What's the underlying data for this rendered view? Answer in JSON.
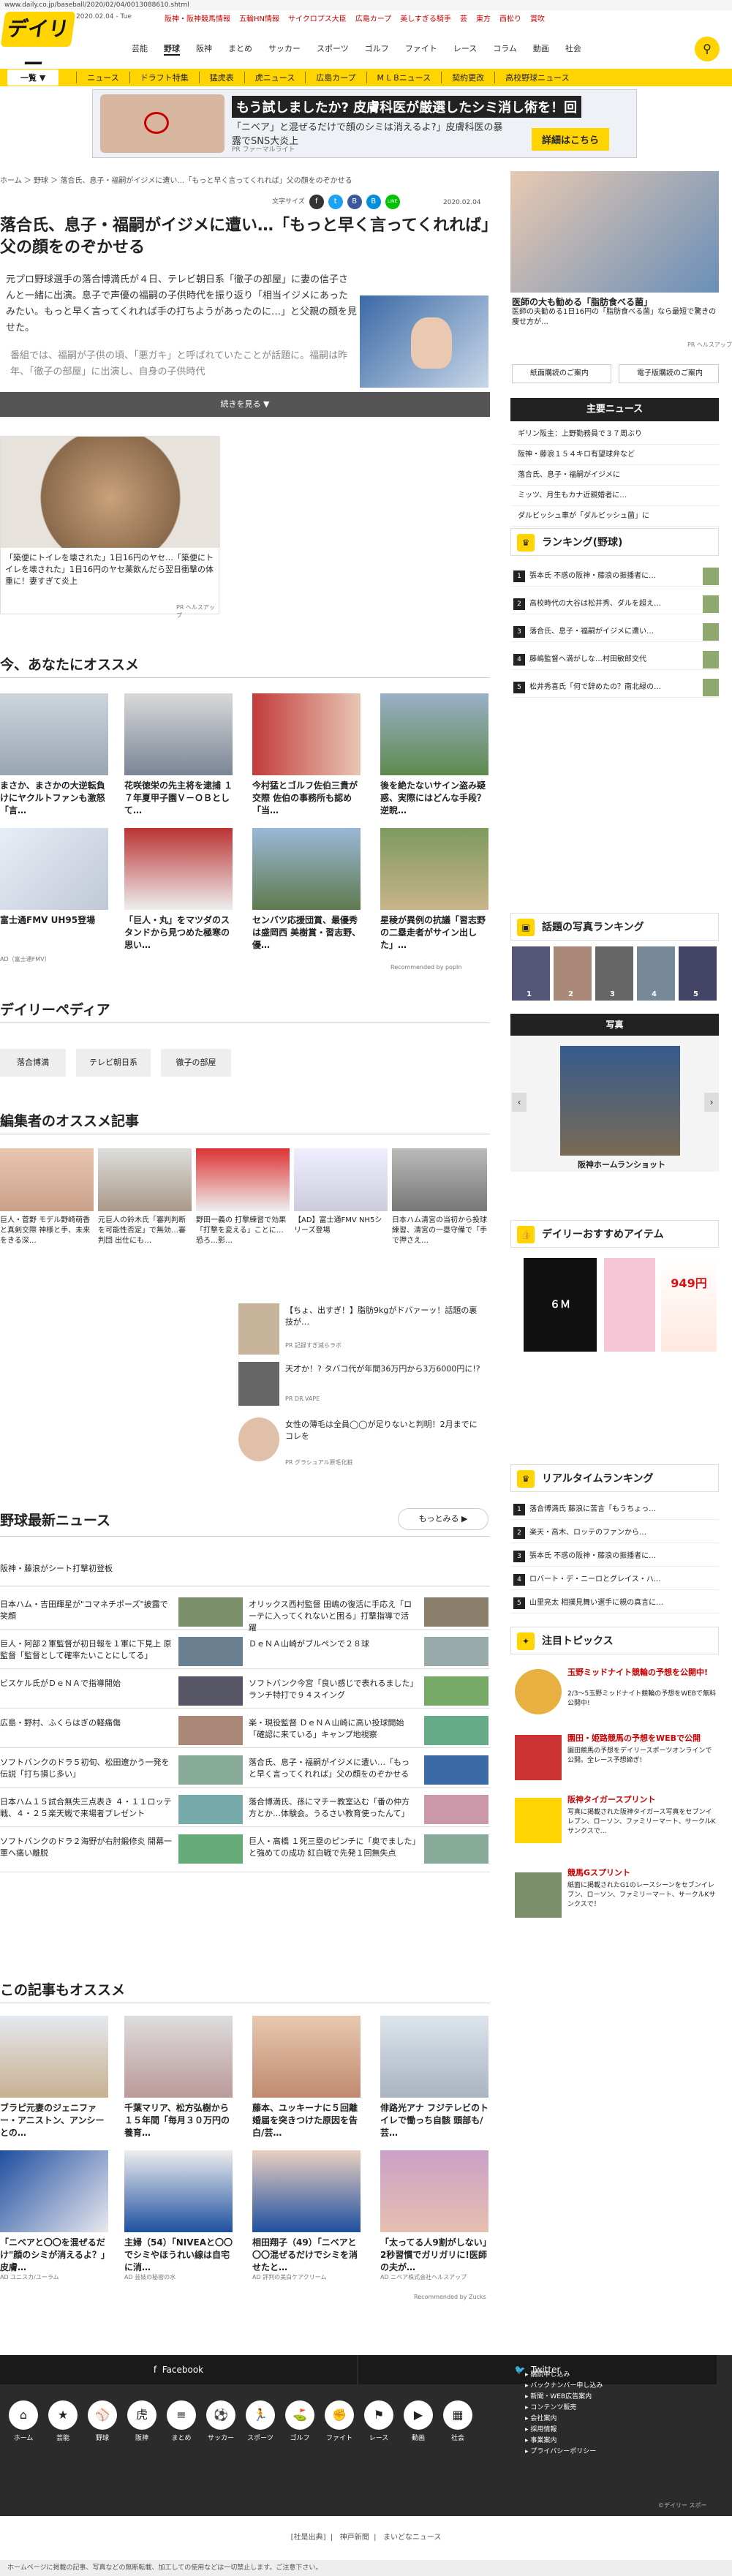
{
  "browser": {
    "url": "www.daily.co.jp/baseball/2020/02/04/0013088610.shtml"
  },
  "header": {
    "logo": "デイリー",
    "date": "2020.02.04 - Tue",
    "red_links": [
      "阪神・阪神競馬情報",
      "五輪HN情報",
      "サイクロプス大臣",
      "広島カープ",
      "美しすぎる騎手",
      "芸",
      "東方",
      "西松り",
      "賞吹"
    ],
    "nav": [
      "芸能",
      "野球",
      "阪神",
      "まとめ",
      "サッカー",
      "スポーツ",
      "ゴルフ",
      "ファイト",
      "レース",
      "コラム",
      "動画",
      "社会"
    ],
    "nav_active": "野球",
    "search_icon": "magnifier"
  },
  "subnav": {
    "ichiran": "一覧 ▼",
    "items": [
      "ニュース",
      "ドラフト特集",
      "猛虎表",
      "虎ニュース",
      "広島カープ",
      "M L Bニュース",
      "契約更改",
      "高校野球ニュース"
    ]
  },
  "ad_top": {
    "headline": "もう試しましたか? 皮膚科医が厳選したシミ消し術を！回",
    "body": "「ニベア」と混ぜるだけで顔のシミは消えるよ?」皮膚科医の暴露でSNS大炎上",
    "button": "詳細はこちら",
    "source": "PR ファーマルライト"
  },
  "breadcrumb": "ホーム ＞ 野球 ＞ 落合氏、息子・福嗣がイジメに遭い…「もっと早く言ってくれれば」父の顔をのぞかせる",
  "article": {
    "font_size_label": "文字サイズ",
    "share": [
      "f",
      "t",
      "B",
      "B",
      "LINE"
    ],
    "date": "2020.02.04",
    "title": "落合氏、息子・福嗣がイジメに遭い…「もっと早く言ってくれれば」父の顔をのぞかせる",
    "lead": "元プロ野球選手の落合博満氏が４日、テレビ朝日系「徹子の部屋」に妻の信子さんと一緒に出演。息子で声優の福嗣の子供時代を振り返り「相当イジメにあったみたい。もっと早く言ってくれれば手の打ちようがあったのに…」と父親の顔を見せた。",
    "lead_faded": "番組では、福嗣が子供の頃、「悪ガキ」と呼ばれていたことが話題に。福嗣は昨年、「徹子の部屋」に出演し、自身の子供時代",
    "read_more": "続きを見る ▼"
  },
  "ad_mid": {
    "caption": "「築便にトイレを壊された」1日16円のヤセ…「築便にトイレを壊された」1日16円のヤセ薬飲んだら翌日衝撃の体重に！妻すぎて炎上",
    "source": "PR ヘルスアップ"
  },
  "recommend": {
    "heading": "今、あなたにオススメ",
    "cards": [
      {
        "text": "まさか、まさかの大逆転負けにヤクルトファンも激怒「言…"
      },
      {
        "text": "花咲徳栄の先主将を逮捕 １７年夏甲子園Ｖ－ＯＢとして…"
      },
      {
        "text": "今村猛とゴルフ佐伯三貴が交際 佐伯の事務所も認め「当…"
      },
      {
        "text": "後を絶たないサイン盗み疑惑、実際にはどんな手段？逆睨…"
      },
      {
        "text": "富士通FMV UH95登場"
      },
      {
        "text": "「巨人・丸」をマツダのスタンドから見つめた極寒の思い…"
      },
      {
        "text": "センバツ応援団賞、最優秀は盛岡西 美樹賞・習志野、優…"
      },
      {
        "text": "星稜が異例の抗議「習志野の二塁走者がサイン出した」…"
      }
    ],
    "ad_label": "AD（富士通FMV）",
    "recommended_by": "Recommended by popIn"
  },
  "pedia": {
    "heading": "デイリーペディア",
    "tags": [
      "落合博満",
      "テレビ朝日系",
      "徹子の部屋"
    ]
  },
  "editor": {
    "heading": "編集者のオススメ記事",
    "cards": [
      {
        "text": "巨人・菅野 モデル野崎萌香と真剣交際 神様と手、未来をきる深…"
      },
      {
        "text": "元巨人の鈴木氏「審判判断を可能性否定」で無効…審判団 出仕にも…"
      },
      {
        "text": "野田一義の 打撃練習で効果「打撃を変える」ことに…恐ろ…影…"
      },
      {
        "text": "【AD】富士通FMV NH5シリーズ登場"
      },
      {
        "text": "日本ハム清宮の当初から投球練習、清宮の一塁守備で「手で押さえ…"
      }
    ],
    "prs": [
      {
        "text": "【ちょ、出すぎ！】脂肪9kgがドバァーッ！話題の裏技が…",
        "src": "PR 記録すぎ減らラボ"
      },
      {
        "text": "天才か！? タバコ代が年間36万円から3万6000円に!?",
        "src": "PR DR.VAPE"
      },
      {
        "text": "女性の薄毛は全員◯◯が足りないと判明！2月までにコレを",
        "src": "PR グラシュアル原毛化粧"
      }
    ]
  },
  "news": {
    "heading": "野球最新ニュース",
    "more": "もっとみる ▶",
    "top_item": "阪神・藤浪がシート打撃初登板",
    "rows": [
      {
        "l": "日本ハム・吉田輝星が\"コマネチポーズ\"披露で笑顔",
        "r": "オリックス西村監督 田嶋の復活に手応え「ローテに入ってくれないと困る」打撃指導で活躍"
      },
      {
        "l": "巨人・阿部２軍監督が初日報を１軍に下見上 原監督「監督として確率たいことにしてる」",
        "r": "ＤｅＮＡ山崎がブルペンで２８球"
      },
      {
        "l": "ビスケル氏がＤｅＮＡで指導開始",
        "r": "ソフトバンク今宮「良い感じで表れるました」ランチ特打で９４スイング"
      },
      {
        "l": "広島・野村、ふくらはぎの軽痛傷",
        "r": "楽・現役監督 ＤｅＮＡ山崎に高い投球開始「確認に来ている」キャンプ地視察"
      },
      {
        "l": "ソフトバンクのドラ５初旬、松田遼かう一発を伝説「打ち損じ多い」",
        "r": "落合氏、息子・福嗣がイジメに遭い…「もっと早く言ってくれれば」父の顔をのぞかせる"
      },
      {
        "l": "日本ハム１５試合無失三点表き ４・１１ロッテ戦、４・２５楽天戦で来場者プレゼント",
        "r": "落合博満氏、孫にマチー教室込む「番の仲方方とか…体験会。うるさい教育使ったんて」"
      },
      {
        "l": "ソフトバンクのドラ２海野が右肘鍛修炎 開幕一軍へ痛い離脱",
        "r": "巨人・高橋 １死三塁のピンチに「奥でました」と強めての成功 紅白戦で先発１回無失点"
      }
    ]
  },
  "bottom_rec": {
    "heading": "この記事もオススメ",
    "cards": [
      {
        "text": "ブラピ元妻のジェニファー・アニストン、アンシーとの…"
      },
      {
        "text": "千葉マリア、松方弘樹から１５年間「毎月３０万円の養育…"
      },
      {
        "text": "藤本、ユッキーナに５回離婚届を突きつけた原因を告白/芸…"
      },
      {
        "text": "俳路光アナ フジテレビのトイレで慟っち自骸 頭部も/芸…"
      },
      {
        "text": "「ニベアと〇〇を混ぜるだけ\"顔のシミが消えるよ？」皮膚…"
      },
      {
        "text": "主婦（54）「NIVEAと〇〇でシミやほうれい線は自宅に消…"
      },
      {
        "text": "相田翔子（49）「ニベアと〇〇混ぜるだけでシミを消せたと…"
      },
      {
        "text": "「太ってる人9割がしない」2秒習慣でガリガリに!医師の夫が…"
      }
    ],
    "ad_srcs": [
      "AD ユニスカ/ユーラム",
      "AD 芸妓の秘密の水",
      "AD 評判の美白ケアクリーム",
      "AD ニベア株式会社ヘルスアップ"
    ],
    "recommended_by": "Recommended by Zucks"
  },
  "rail": {
    "ad_cap": "医師の大も勧める「脂肪食べる菌」",
    "ad_body": "医師の夫勧める1日16円の「脂肪食べる菌」なら最短で驚きの痩せ方が…",
    "ad_src": "PR ヘルスアップ",
    "buttons": [
      "紙面購読のご案内",
      "電子版購読のご案内"
    ],
    "main_news_title": "主要ニュース",
    "main_news_more": "▶",
    "main_news": [
      "ギリン阪主：上野勤務員で３７周ぶり",
      "阪神・藤浪１５４キロ有望球弁など",
      "落合氏、息子・福嗣がイジメに",
      "ミッツ、月生もカナ近親婚者に…",
      "ダルビッシュ車が「ダルビッシュ菌」に"
    ],
    "ranking_title": "ランキング(野球)",
    "ranking": [
      "張本氏 不惑の阪神・藤浪の振播者に…",
      "高校時代の大谷は松井秀、ダルを超え…",
      "落合氏、息子・福嗣がイジメに遭い…",
      "藤嶋監督ヘ満がしな…村田敏郎交代",
      "松井秀喜氏「何で辞めたの？南北緑の…"
    ],
    "photo_rank_title": "話題の写真ランキング",
    "photo_rank": [
      "1",
      "2",
      "3",
      "4",
      "5"
    ],
    "photo_title": "写真",
    "photo_caption": "阪神ホームランショット",
    "item_title": "デイリーおすすめアイテム",
    "item_labels": [
      "６Ｍ",
      "949円"
    ],
    "realtime_title": "リアルタイムランキング",
    "realtime": [
      "落合博満氏 藤浪に苦言「もうちょっ…",
      "楽天・高木、ロッテのファンから…",
      "張本氏 不惑の阪神・藤浪の振播者に…",
      "ロバート・デ・ニーロとグレイス・ハ…",
      "山里亮太 相撲見舞い選手に親の真言に…"
    ],
    "topics_title": "注目トピックス",
    "topics": [
      {
        "t": "玉野ミッドナイト競輪の予想を公開中!",
        "b": "2/3～5玉野ミッドナイト競輪の予想をWEBで無料公開中!"
      },
      {
        "t": "園田・姫路競馬の予想をWEBで公開",
        "b": "園田競馬の予想をデイリースポーツオンラインで公開。全レース予想締ぎ!"
      },
      {
        "t": "阪神タイガースプリント",
        "b": "写真に掲載された阪神タイガース写真をセブンイレブン、ローソン、ファミリーマート、サークルKサンクスで…"
      },
      {
        "t": "競馬Gスプリント",
        "b": "紙面に掲載されたG1のレースシーンをセブンイレブン、ローソン、ファミリーマート、サークルKサンクスで！"
      }
    ]
  },
  "footer": {
    "facebook": "Facebook",
    "twitter": "Twitter",
    "cats": [
      "ホーム",
      "芸能",
      "野球",
      "阪神",
      "まとめ",
      "サッカー",
      "スポーツ",
      "ゴルフ",
      "ファイト",
      "レース",
      "動画",
      "社会"
    ],
    "links": [
      "▸ 購読申し込み",
      "▸ バックナンバー申し込み",
      "▸ 新聞・WEB広告案内",
      "▸ コンテンツ販売",
      "▸ 会社案内",
      "▸ 採用情報",
      "▸ 事業案内",
      "▸ プライバシーポリシー"
    ],
    "right_label": "©デイリー スポー",
    "sub": [
      "[社是出典]",
      "神戸新聞",
      "まいどなニュース"
    ],
    "copyright": "ホームページに掲載の記事、写真などの無断転載、加工しての使用などは一切禁止します。ご注意下さい。"
  }
}
